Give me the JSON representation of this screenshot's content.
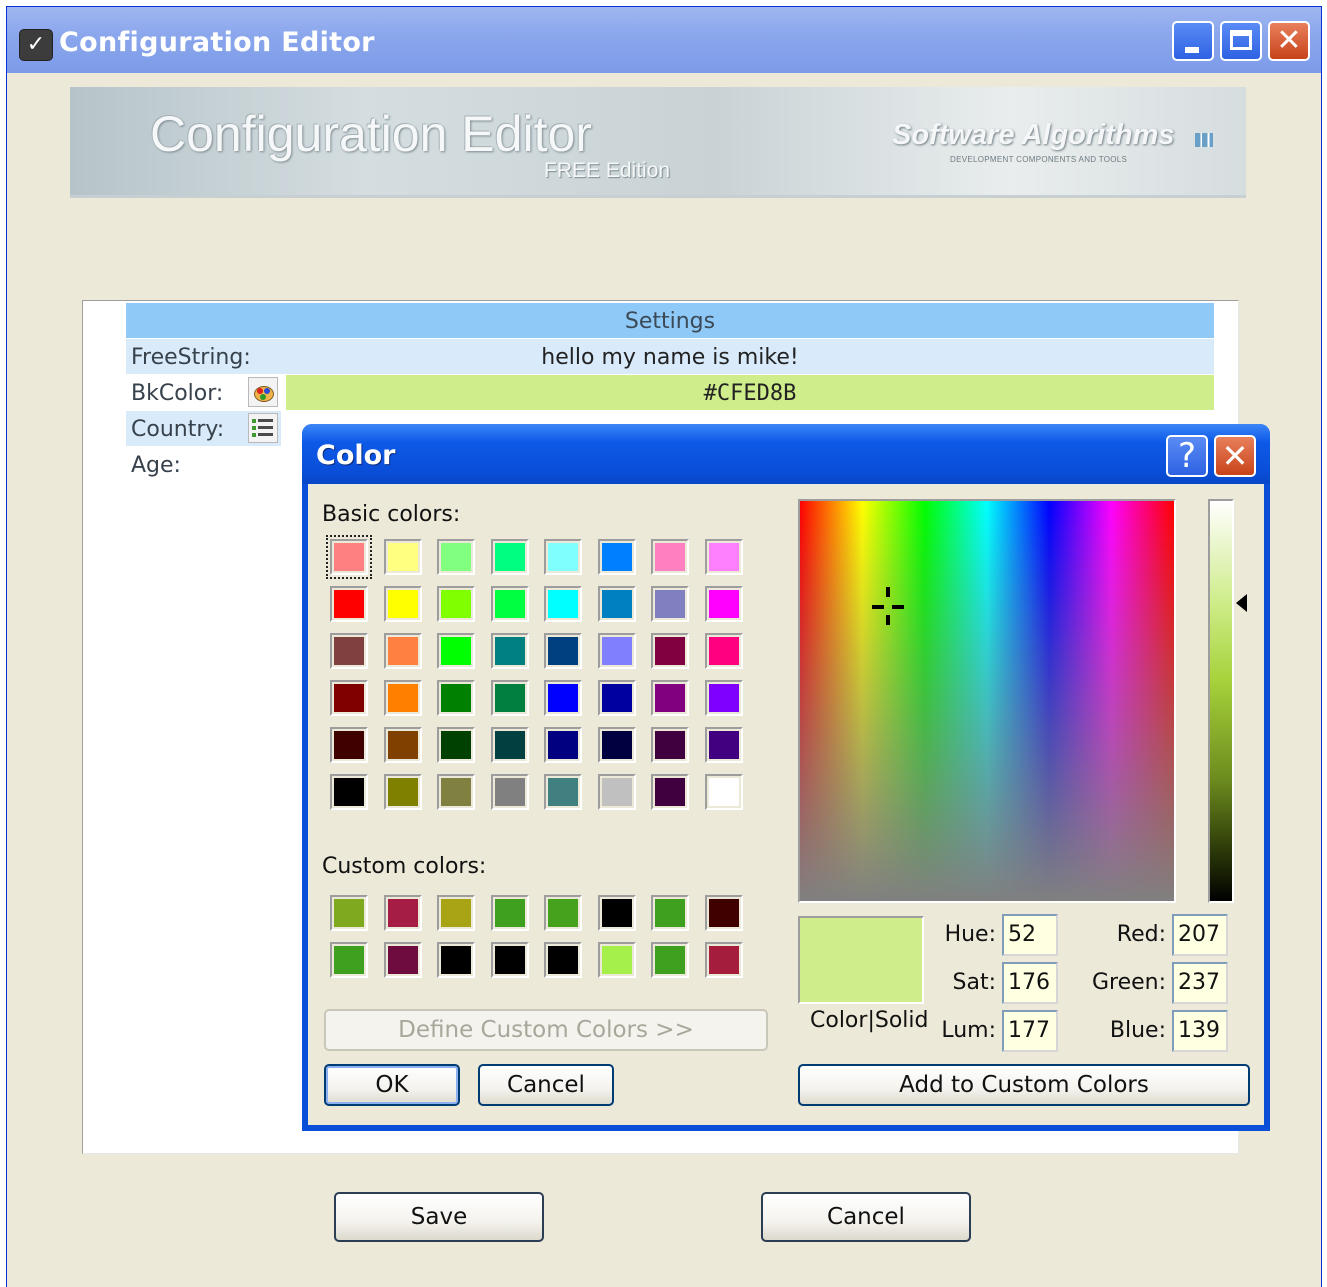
{
  "window": {
    "title": "Configuration Editor",
    "controls": [
      "minimize",
      "maximize",
      "close"
    ]
  },
  "banner": {
    "title": "Configuration Editor",
    "edition": "FREE Edition",
    "brand": "Software Algorithms",
    "tagline": "DEVELOPMENT COMPONENTS AND TOOLS"
  },
  "grid": {
    "header": "Settings",
    "rows": [
      {
        "label": "FreeString:",
        "value": "hello my name is mike!"
      },
      {
        "label": "BkColor:",
        "value": "#CFED8B",
        "icon": "palette-icon"
      },
      {
        "label": "Country:",
        "value": "",
        "icon": "list-icon"
      },
      {
        "label": "Age:",
        "value": ""
      }
    ]
  },
  "color_dialog": {
    "title": "Color",
    "help_label": "?",
    "close_label": "✕",
    "basic_colors_label": "Basic colors:",
    "custom_colors_label": "Custom colors:",
    "basic_colors": [
      [
        "#ff8080",
        "#ffff80",
        "#80ff80",
        "#00ff80",
        "#80ffff",
        "#0080ff",
        "#ff80c0",
        "#ff80ff"
      ],
      [
        "#ff0000",
        "#ffff00",
        "#80ff00",
        "#00ff40",
        "#00ffff",
        "#0080c0",
        "#8080c0",
        "#ff00ff"
      ],
      [
        "#804040",
        "#ff8040",
        "#00ff00",
        "#008080",
        "#004080",
        "#8080ff",
        "#800040",
        "#ff0080"
      ],
      [
        "#800000",
        "#ff8000",
        "#008000",
        "#008040",
        "#0000ff",
        "#0000a0",
        "#800080",
        "#8000ff"
      ],
      [
        "#400000",
        "#804000",
        "#004000",
        "#004040",
        "#000080",
        "#000040",
        "#400040",
        "#400080"
      ],
      [
        "#000000",
        "#808000",
        "#808040",
        "#808080",
        "#408080",
        "#c0c0c0",
        "#400040",
        "#ffffff"
      ]
    ],
    "custom_colors": [
      [
        "#7fa91e",
        "#a51d45",
        "#a8a416",
        "#3f9f1f",
        "#46a11c",
        "#000000",
        "#3f9f1f",
        "#400000"
      ],
      [
        "#3f9f1f",
        "#6e0c40",
        "#000000",
        "#000000",
        "#000000",
        "#a6f04c",
        "#3f9f1f",
        "#a51d3c"
      ]
    ],
    "selected_basic": [
      0,
      0
    ],
    "define_custom_label": "Define Custom Colors >>",
    "ok_label": "OK",
    "cancel_label": "Cancel",
    "add_custom_label": "Add to Custom Colors",
    "preview_label": "Color|Solid",
    "preview_color": "#cfed8b",
    "hue_label": "Hue:",
    "sat_label": "Sat:",
    "lum_label": "Lum:",
    "red_label": "Red:",
    "green_label": "Green:",
    "blue_label": "Blue:",
    "hue": "52",
    "sat": "176",
    "lum": "177",
    "red": "207",
    "green": "237",
    "blue": "139"
  },
  "footer": {
    "save_label": "Save",
    "cancel_label": "Cancel"
  }
}
